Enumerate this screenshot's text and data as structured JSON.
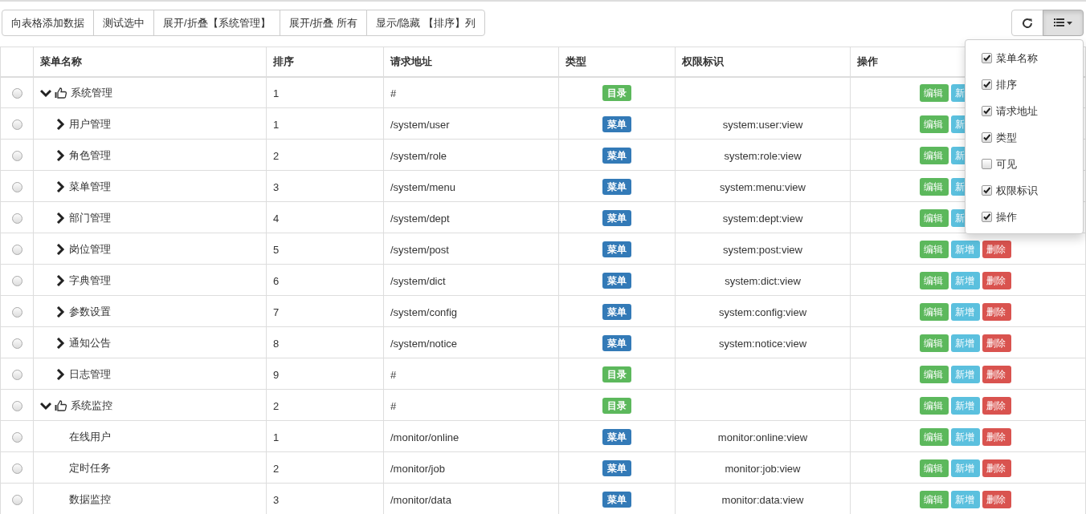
{
  "toolbar": {
    "buttons": [
      "向表格添加数据",
      "测试选中",
      "展开/折叠【系统管理】",
      "展开/折叠 所有",
      "显示/隐藏 【排序】列"
    ]
  },
  "column_menu": {
    "open": true,
    "items": [
      {
        "label": "菜单名称",
        "checked": true
      },
      {
        "label": "排序",
        "checked": true
      },
      {
        "label": "请求地址",
        "checked": true
      },
      {
        "label": "类型",
        "checked": true
      },
      {
        "label": "可见",
        "checked": false
      },
      {
        "label": "权限标识",
        "checked": true
      },
      {
        "label": "操作",
        "checked": true
      }
    ]
  },
  "table": {
    "columns": [
      "菜单名称",
      "排序",
      "请求地址",
      "类型",
      "权限标识",
      "操作"
    ],
    "rows": [
      {
        "selected": false,
        "name": "系统管理",
        "expanded": true,
        "order": "1",
        "url": "#",
        "type": {
          "label": "目录",
          "color": "#5cb85c"
        },
        "actions": [
          "编辑",
          "新"
        ],
        "children": [
          {
            "selected": false,
            "name": "用户管理",
            "expanded": false,
            "order": "1",
            "url": "/system/user",
            "type": {
              "label": "菜单",
              "color": "#337ab7"
            },
            "perm": "system:user:view",
            "actions": [
              "编辑",
              "新"
            ]
          },
          {
            "selected": false,
            "name": "角色管理",
            "expanded": false,
            "order": "2",
            "url": "/system/role",
            "type": {
              "label": "菜单",
              "color": "#337ab7"
            },
            "perm": "system:role:view",
            "actions": [
              "编辑",
              "新"
            ]
          },
          {
            "selected": false,
            "name": "菜单管理",
            "expanded": false,
            "order": "3",
            "url": "/system/menu",
            "type": {
              "label": "菜单",
              "color": "#337ab7"
            },
            "perm": "system:menu:view",
            "actions": [
              "编辑",
              "新"
            ]
          },
          {
            "selected": false,
            "name": "部门管理",
            "expanded": false,
            "order": "4",
            "url": "/system/dept",
            "type": {
              "label": "菜单",
              "color": "#337ab7"
            },
            "perm": "system:dept:view",
            "actions": [
              "编辑",
              "新"
            ]
          },
          {
            "selected": false,
            "name": "岗位管理",
            "expanded": false,
            "order": "5",
            "url": "/system/post",
            "type": {
              "label": "菜单",
              "color": "#337ab7"
            },
            "perm": "system:post:view",
            "actions": [
              "编辑",
              "新增",
              "删除"
            ]
          },
          {
            "selected": false,
            "name": "字典管理",
            "expanded": false,
            "order": "6",
            "url": "/system/dict",
            "type": {
              "label": "菜单",
              "color": "#337ab7"
            },
            "perm": "system:dict:view",
            "actions": [
              "编辑",
              "新增",
              "删除"
            ]
          },
          {
            "selected": false,
            "name": "参数设置",
            "expanded": false,
            "order": "7",
            "url": "/system/config",
            "type": {
              "label": "菜单",
              "color": "#337ab7"
            },
            "perm": "system:config:view",
            "actions": [
              "编辑",
              "新增",
              "删除"
            ]
          },
          {
            "selected": false,
            "name": "通知公告",
            "expanded": false,
            "order": "8",
            "url": "/system/notice",
            "type": {
              "label": "菜单",
              "color": "#337ab7"
            },
            "perm": "system:notice:view",
            "actions": [
              "编辑",
              "新增",
              "删除"
            ]
          },
          {
            "selected": false,
            "name": "日志管理",
            "expanded": false,
            "order": "9",
            "url": "#",
            "type": {
              "label": "目录",
              "color": "#5cb85c"
            },
            "actions": [
              "编辑",
              "新增",
              "删除"
            ]
          }
        ]
      },
      {
        "selected": false,
        "name": "系统监控",
        "expanded": true,
        "order": "2",
        "url": "#",
        "type": {
          "label": "目录",
          "color": "#5cb85c"
        },
        "actions": [
          "编辑",
          "新增",
          "删除"
        ],
        "children": [
          {
            "selected": false,
            "name": "在线用户",
            "order": "1",
            "url": "/monitor/online",
            "type": {
              "label": "菜单",
              "color": "#337ab7"
            },
            "perm": "monitor:online:view",
            "actions": [
              "编辑",
              "新增",
              "删除"
            ]
          },
          {
            "selected": false,
            "name": "定时任务",
            "order": "2",
            "url": "/monitor/job",
            "type": {
              "label": "菜单",
              "color": "#337ab7"
            },
            "perm": "monitor:job:view",
            "actions": [
              "编辑",
              "新增",
              "删除"
            ]
          },
          {
            "selected": false,
            "name": "数据监控",
            "order": "3",
            "url": "/monitor/data",
            "type": {
              "label": "菜单",
              "color": "#337ab7"
            },
            "perm": "monitor:data:view",
            "actions": [
              "编辑",
              "新增",
              "删除"
            ]
          }
        ]
      }
    ]
  }
}
